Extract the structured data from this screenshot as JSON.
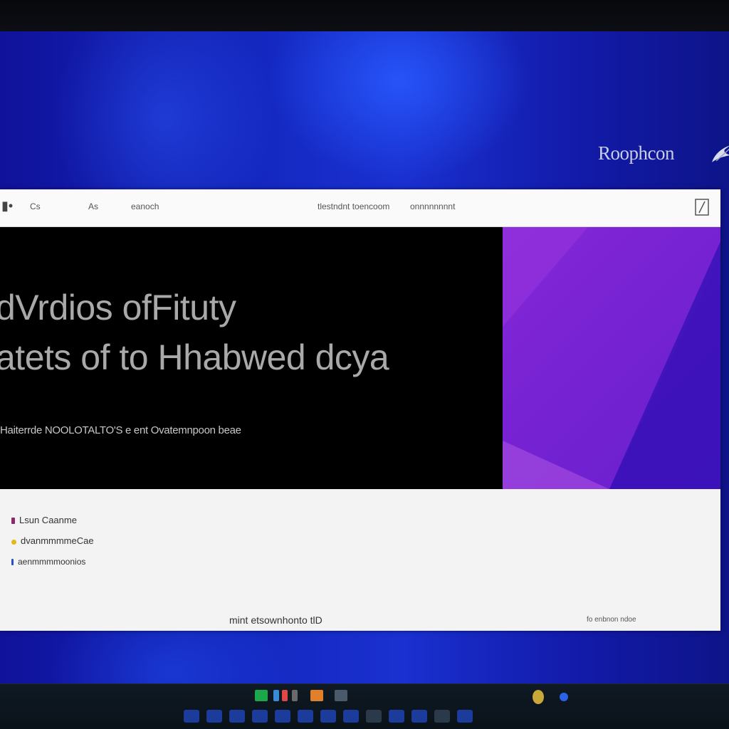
{
  "desktop": {
    "brand_logo": "Roophcon"
  },
  "window": {
    "topbar": {
      "items": [
        "Cs",
        "As",
        "eanoch",
        "tlestndnt toencoom",
        "onnnnnnnnt"
      ],
      "left_icon": "sidebar-icon",
      "right_icon": "window-controls-icon"
    },
    "hero": {
      "title_line1": "dVrdios ofFituty",
      "title_line2": "atets of to Hhabwed dcya",
      "subtitle": "Haiterrde NOOLOTALTO'S e ent Ovatemnpoon beae"
    },
    "bullets": [
      {
        "text": "Lsun Caanme",
        "color": "#8a2a6a"
      },
      {
        "text": "dvanmmmmeCae",
        "color": "#e0b81a"
      },
      {
        "text": "aenmmmmoonios",
        "color": "#2a52c8"
      }
    ],
    "footer": {
      "center": "mint etsownhonto tlD",
      "right": "fo enbnon ndoe"
    }
  },
  "colors": {
    "wallpaper": "#1428c0",
    "hero_art": "#7a22d4",
    "accent": "#8a2ad8"
  }
}
